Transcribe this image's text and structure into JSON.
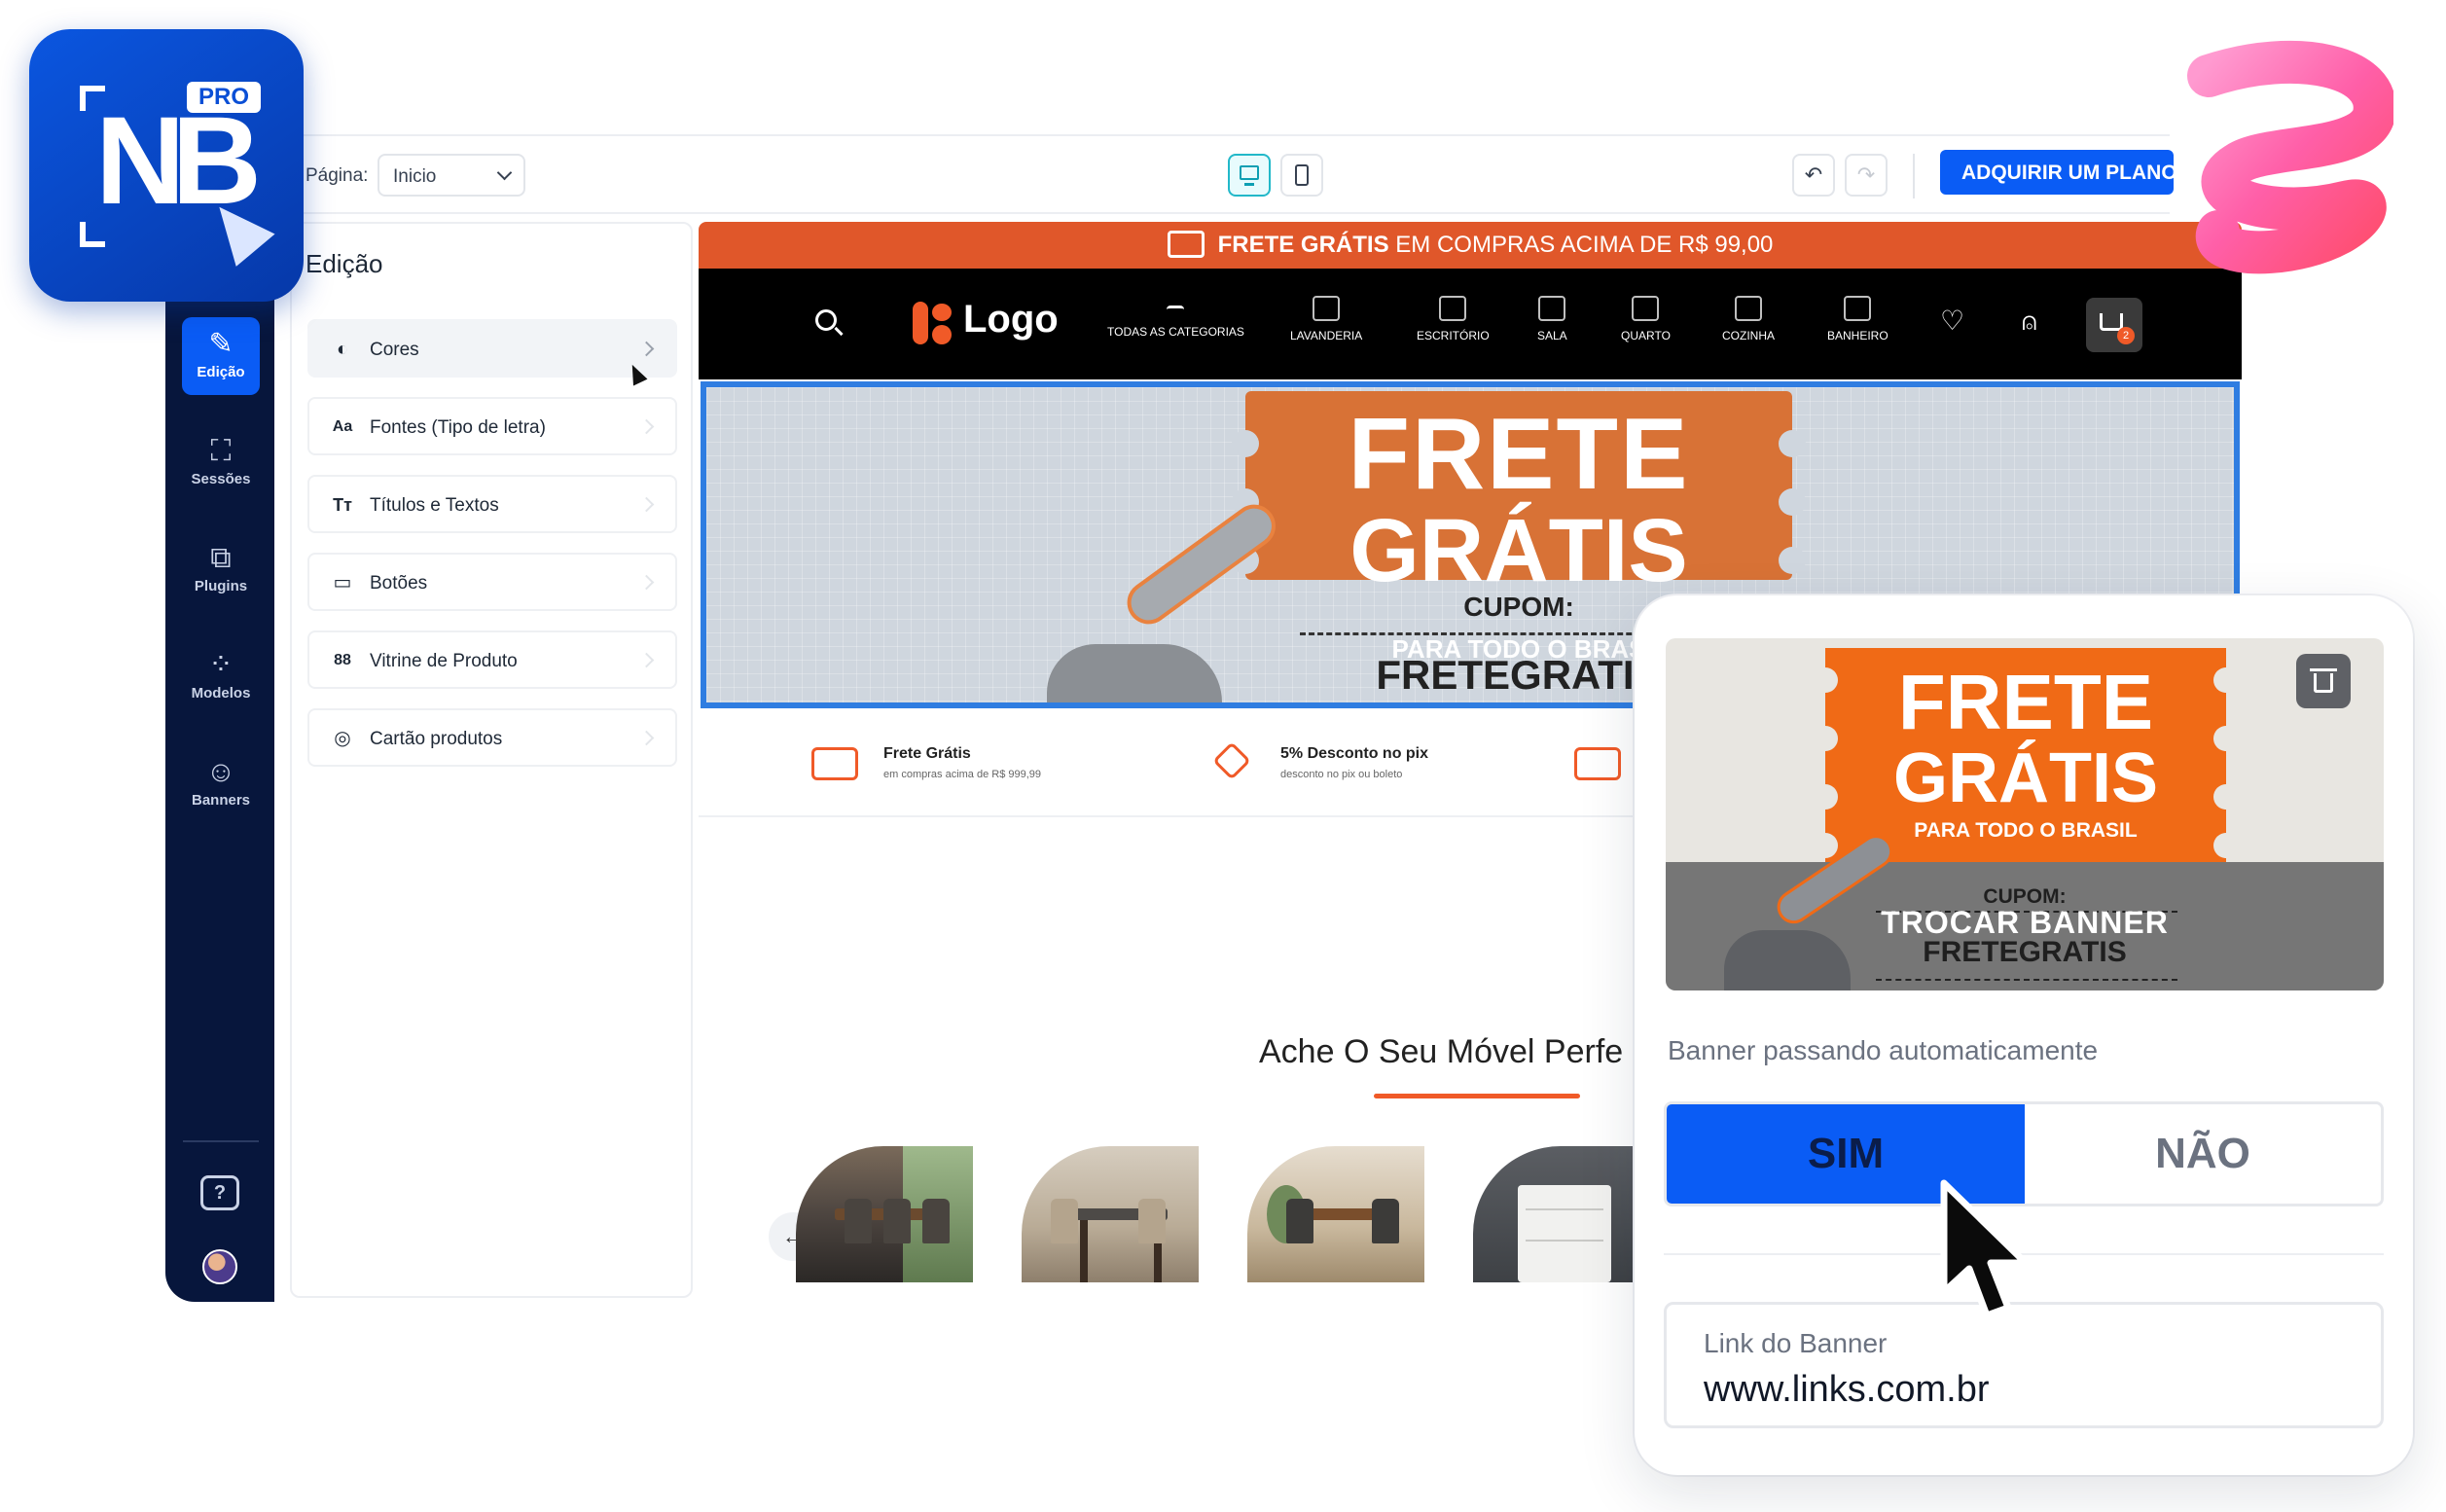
{
  "brand": {
    "logo_text": "NB",
    "badge": "PRO"
  },
  "topbar": {
    "page_label": "Página:",
    "page_value": "Inicio",
    "buy_button": "ADQUIRIR UM PLANO"
  },
  "sidebar": {
    "items": [
      {
        "label": "Edição",
        "icon": "pencil-icon"
      },
      {
        "label": "Sessões",
        "icon": "frame-icon"
      },
      {
        "label": "Plugins",
        "icon": "puzzle-icon"
      },
      {
        "label": "Modelos",
        "icon": "grid-icon"
      },
      {
        "label": "Banners",
        "icon": "image-icon"
      }
    ],
    "help_icon": "?"
  },
  "settings": {
    "title": "Edição",
    "items": [
      {
        "label": "Cores",
        "icon": "palette-icon"
      },
      {
        "label": "Fontes (Tipo de letra)",
        "icon": "font-icon"
      },
      {
        "label": "Títulos e Textos",
        "icon": "text-icon"
      },
      {
        "label": "Botões",
        "icon": "button-icon"
      },
      {
        "label": "Vitrine de Produto",
        "icon": "grid-icon"
      },
      {
        "label": "Cartão produtos",
        "icon": "card-icon"
      }
    ],
    "glyphs": {
      "font": "Aa",
      "text": "Tт",
      "grid": "88"
    }
  },
  "store": {
    "promo_bold": "FRETE GRÁTIS",
    "promo_rest": "EM COMPRAS ACIMA DE R$ 99,00",
    "logo": "Logo",
    "categories": [
      "TODAS AS CATEGORIAS",
      "LAVANDERIA",
      "ESCRITÓRIO",
      "SALA",
      "QUARTO",
      "COZINHA",
      "BANHEIRO"
    ],
    "cart_count": "2",
    "hero": {
      "line1": "FRETE",
      "line2": "GRÁTIS",
      "line3": "PARA TODO O BRAS",
      "coupon_label": "CUPOM:",
      "coupon_code": "FRETEGRATIS"
    },
    "benefits": [
      {
        "title": "Frete Grátis",
        "subtitle": "em compras acima de R$ 999,99"
      },
      {
        "title": "5% Desconto no pix",
        "subtitle": "desconto no pix ou boleto"
      }
    ],
    "section_title": "Ache O Seu Móvel Perfe",
    "prev_arrow": "←"
  },
  "banner_card": {
    "banner": {
      "line1": "FRETE",
      "line2": "GRÁTIS",
      "line3": "PARA TODO O BRASIL",
      "coupon_label": "CUPOM:",
      "overlay_text": "TROCAR BANNER",
      "coupon_code": "FRETEGRATIS"
    },
    "auto_label": "Banner passando automaticamente",
    "toggle_yes": "SIM",
    "toggle_no": "NÃO",
    "toggle_selected": "SIM",
    "link_label": "Link do Banner",
    "link_value": "www.links.com.br"
  },
  "colors": {
    "primary_blue": "#0a5cf5",
    "sidebar_navy": "#07163c",
    "store_orange": "#e0572a",
    "hero_border": "#2f7de1"
  }
}
